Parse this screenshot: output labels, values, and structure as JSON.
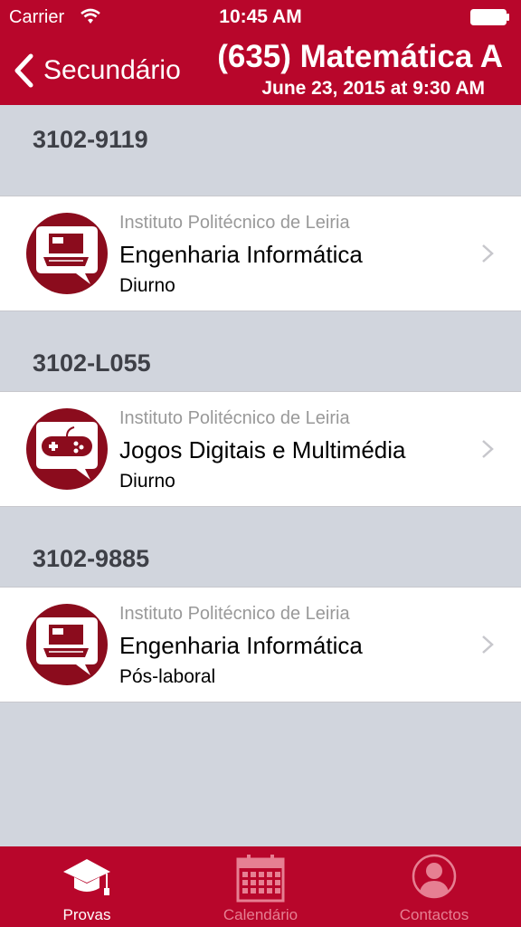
{
  "status": {
    "carrier": "Carrier",
    "time": "10:45 AM"
  },
  "nav": {
    "back_label": "Secundário",
    "title": "(635) Matemática A",
    "subtitle": "June 23, 2015 at 9:30 AM"
  },
  "sections": [
    {
      "code": "3102-9119",
      "institution": "Instituto Politécnico de Leiria",
      "course": "Engenharia Informática",
      "regime": "Diurno",
      "icon": "laptop-icon"
    },
    {
      "code": "3102-L055",
      "institution": "Instituto Politécnico de Leiria",
      "course": "Jogos Digitais e Multimédia",
      "regime": "Diurno",
      "icon": "gamepad-icon"
    },
    {
      "code": "3102-9885",
      "institution": "Instituto Politécnico de Leiria",
      "course": "Engenharia Informática",
      "regime": "Pós-laboral",
      "icon": "laptop-icon"
    }
  ],
  "tabs": [
    {
      "label": "Provas",
      "icon": "graduation-cap-icon",
      "active": true
    },
    {
      "label": "Calendário",
      "icon": "calendar-icon",
      "active": false
    },
    {
      "label": "Contactos",
      "icon": "person-icon",
      "active": false
    }
  ],
  "colors": {
    "brand": "#b8062b",
    "icon_circle": "#8b0c1d",
    "background": "#d1d5dd",
    "tab_inactive": "#e67f92"
  }
}
